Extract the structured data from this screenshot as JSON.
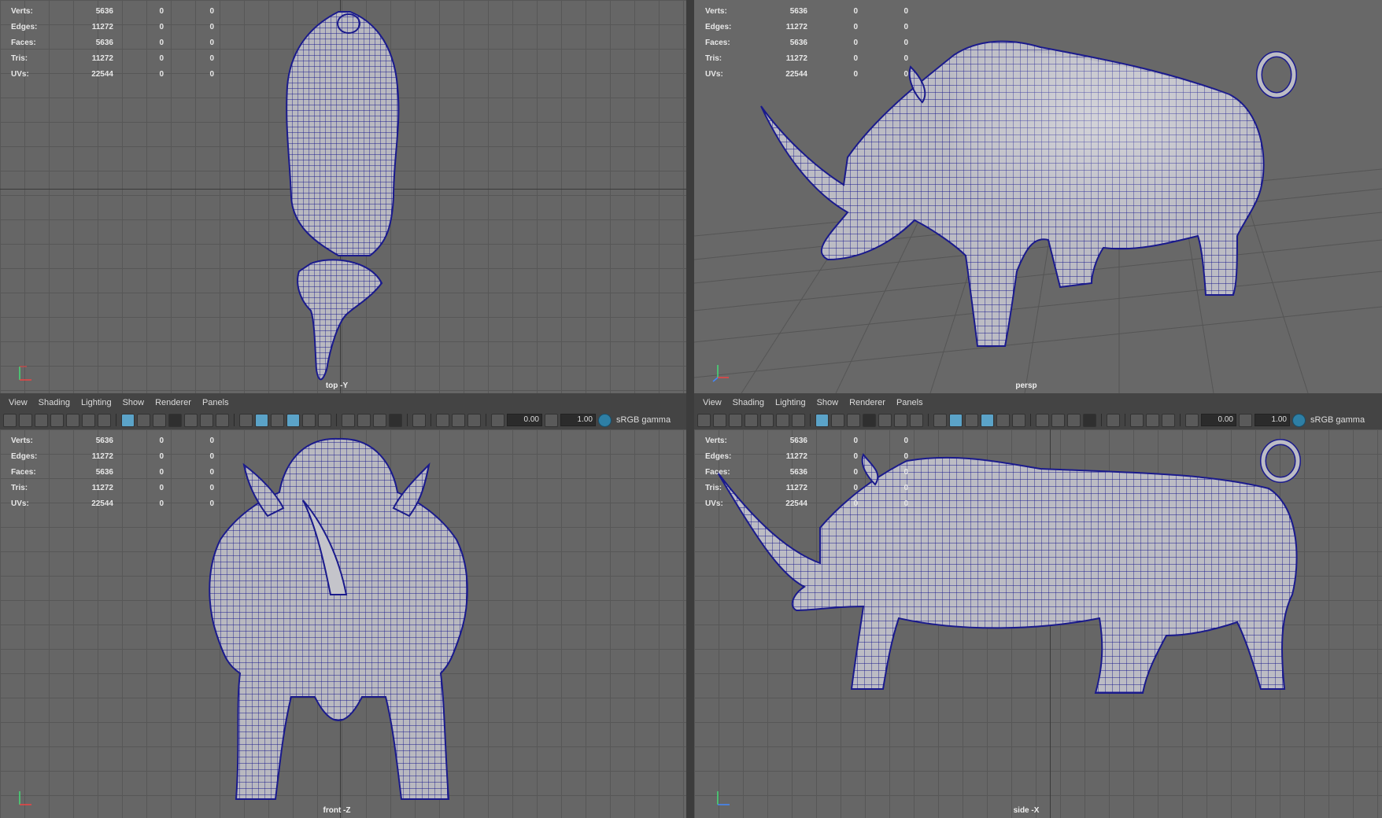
{
  "hud": {
    "rows": [
      {
        "label": "Verts:",
        "v1": "5636",
        "v2": "0",
        "v3": "0"
      },
      {
        "label": "Edges:",
        "v1": "11272",
        "v2": "0",
        "v3": "0"
      },
      {
        "label": "Faces:",
        "v1": "5636",
        "v2": "0",
        "v3": "0"
      },
      {
        "label": "Tris:",
        "v1": "11272",
        "v2": "0",
        "v3": "0"
      },
      {
        "label": "UVs:",
        "v1": "22544",
        "v2": "0",
        "v3": "0"
      }
    ]
  },
  "viewports": {
    "top": {
      "camera": "top -Y"
    },
    "persp": {
      "camera": "persp"
    },
    "front": {
      "camera": "front -Z"
    },
    "side": {
      "camera": "side -X"
    }
  },
  "panel_menu": [
    "View",
    "Shading",
    "Lighting",
    "Show",
    "Renderer",
    "Panels"
  ],
  "toolbar": {
    "exposure": "0.00",
    "gamma": "1.00",
    "color_space": "sRGB gamma"
  },
  "colors": {
    "viewport_bg": "#666666",
    "grid": "#575757",
    "wire": "#1a1a8c",
    "mesh_fill": "#b8b8be",
    "active_icon": "#5ba3c8"
  },
  "icons": [
    "camera-icon",
    "lock-camera-icon",
    "bookmark-icon",
    "image-plane-icon",
    "grid-icon",
    "film-gate-icon",
    "resolution-gate-icon",
    "wireframe-icon",
    "smooth-shade-icon",
    "textured-icon",
    "lights-icon",
    "shadows-icon",
    "isolate-icon",
    "xray-icon",
    "exposure-icon",
    "gamma-icon",
    "color-management-icon"
  ]
}
